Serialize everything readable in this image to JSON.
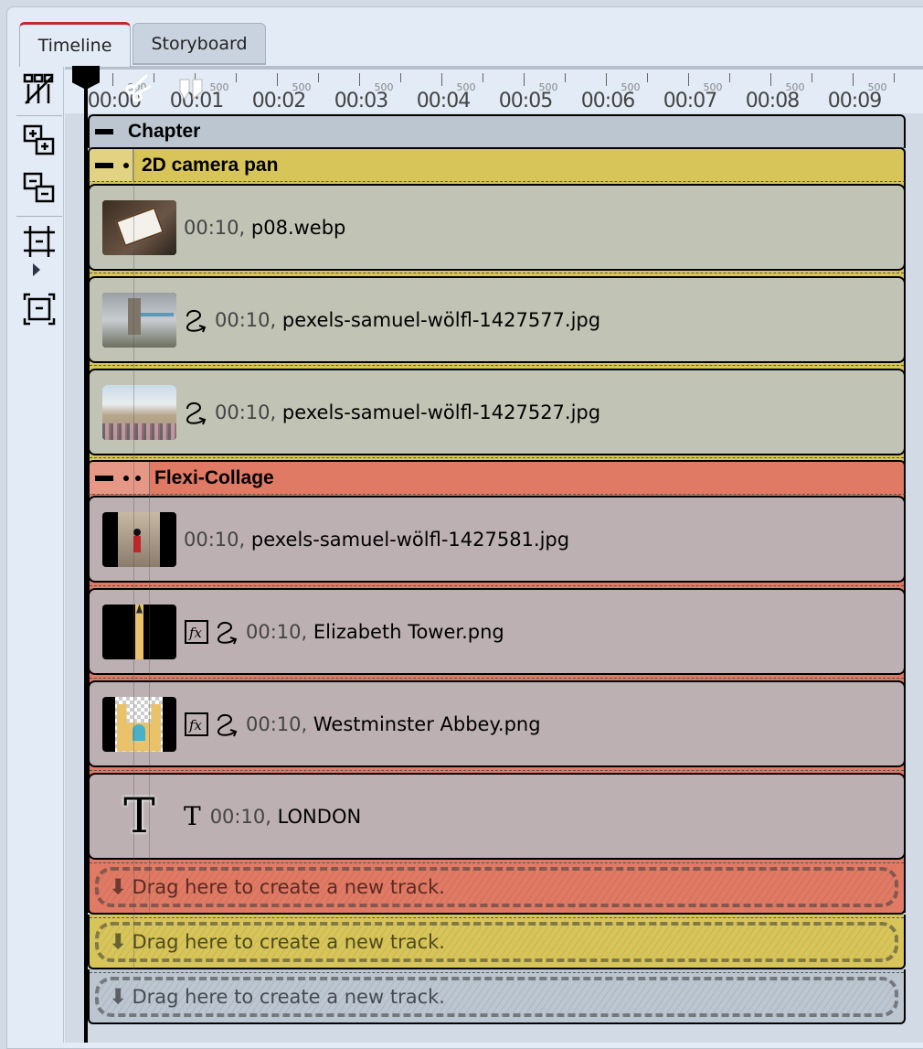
{
  "tabs": [
    {
      "label": "Timeline",
      "active": true
    },
    {
      "label": "Storyboard",
      "active": false
    }
  ],
  "toolbar": {
    "buttons": [
      {
        "name": "split-tracks-icon"
      },
      {
        "name": "expand-all-icon"
      },
      {
        "name": "collapse-all-icon"
      },
      {
        "name": "zoom-fit-icon"
      },
      {
        "name": "zoom-expand-icon"
      }
    ]
  },
  "ruler": {
    "major_labels": [
      "00:00",
      "00:01",
      "00:02",
      "00:03",
      "00:04",
      "00:05",
      "00:06",
      "00:07",
      "00:08",
      "00:09"
    ],
    "sub_label": "500"
  },
  "colors": {
    "chapter": "#bcc6d1",
    "camera_pan": "#d8c55a",
    "flexi_collage": "#e07a64",
    "clip_gray": "#c1c3b5",
    "clip_mauve": "#bcb0b3",
    "tab_accent": "#c0282a"
  },
  "chapter": {
    "title": "Chapter",
    "groups": [
      {
        "title": "2D camera pan",
        "clips": [
          {
            "duration": "00:10,",
            "name": "p08.webp",
            "icons": []
          },
          {
            "duration": "00:10,",
            "name": "pexels-samuel-wölfl-1427577.jpg",
            "icons": [
              "motion-path-icon"
            ]
          },
          {
            "duration": "00:10,",
            "name": "pexels-samuel-wölfl-1427527.jpg",
            "icons": [
              "motion-path-icon"
            ]
          }
        ]
      },
      {
        "title": "Flexi-Collage",
        "clips": [
          {
            "duration": "00:10,",
            "name": "pexels-samuel-wölfl-1427581.jpg",
            "icons": []
          },
          {
            "duration": "00:10,",
            "name": "Elizabeth Tower.png",
            "icons": [
              "fx-icon",
              "motion-path-icon"
            ]
          },
          {
            "duration": "00:10,",
            "name": "Westminster Abbey.png",
            "icons": [
              "fx-icon",
              "motion-path-icon"
            ]
          },
          {
            "duration": "00:10,",
            "name": "LONDON",
            "icons": [
              "text-icon"
            ]
          }
        ]
      }
    ]
  },
  "drop_zones": [
    {
      "label": "Drag here to create a new track."
    },
    {
      "label": "Drag here to create a new track."
    },
    {
      "label": "Drag here to create a new track."
    }
  ]
}
